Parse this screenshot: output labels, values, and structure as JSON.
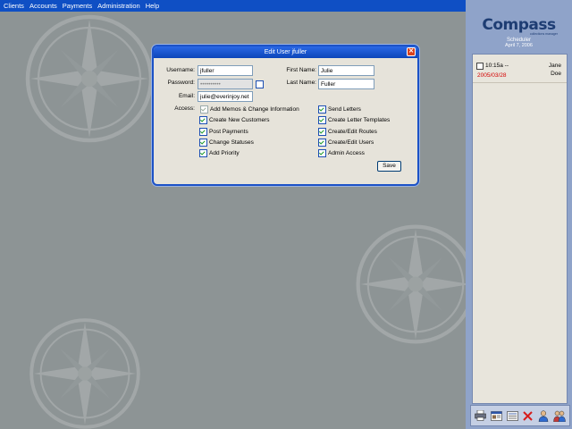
{
  "menu": [
    "Clients",
    "Accounts",
    "Payments",
    "Administration",
    "Help"
  ],
  "dialog": {
    "title": "Edit User jfuller",
    "close_glyph": "✕",
    "labels": {
      "username": "Username:",
      "password": "Password:",
      "email": "Email:",
      "access": "Access:",
      "first_name": "First Name:",
      "last_name": "Last Name:"
    },
    "values": {
      "username": "jfuller",
      "password": "••••••••••",
      "email": "julie@everinjoy.net",
      "first_name": "Julie",
      "last_name": "Fuller"
    },
    "access_left": [
      {
        "label": "Add Memos & Change Information",
        "checked": true
      },
      {
        "label": "Create New Customers",
        "checked": true
      },
      {
        "label": "Post Payments",
        "checked": true
      },
      {
        "label": "Change Statuses",
        "checked": true
      },
      {
        "label": "Add Priority",
        "checked": true
      }
    ],
    "access_right": [
      {
        "label": "Send Letters",
        "checked": true
      },
      {
        "label": "Create Letter Templates",
        "checked": true
      },
      {
        "label": "Create/Edit Routes",
        "checked": true
      },
      {
        "label": "Create/Edit Users",
        "checked": true
      },
      {
        "label": "Admin Access",
        "checked": true
      }
    ],
    "save_label": "Save"
  },
  "sidepanel": {
    "logo": "Compass",
    "logo_sub": "collections manager",
    "title": "Scheduler",
    "date": "April 7, 2006",
    "appointments": [
      {
        "time": "10:15a --",
        "date": "2005/03/28",
        "name_first": "Jane",
        "name_last": "Doe"
      }
    ],
    "toolbar_icons": [
      "printer-icon",
      "card-icon",
      "list-icon",
      "delete-icon",
      "user-icon",
      "users-icon"
    ]
  },
  "colors": {
    "menubar": "#0f4fc4",
    "desktop": "#8d9495",
    "sidepanel": "#8fa3c9",
    "appointment_date": "#d40000"
  }
}
